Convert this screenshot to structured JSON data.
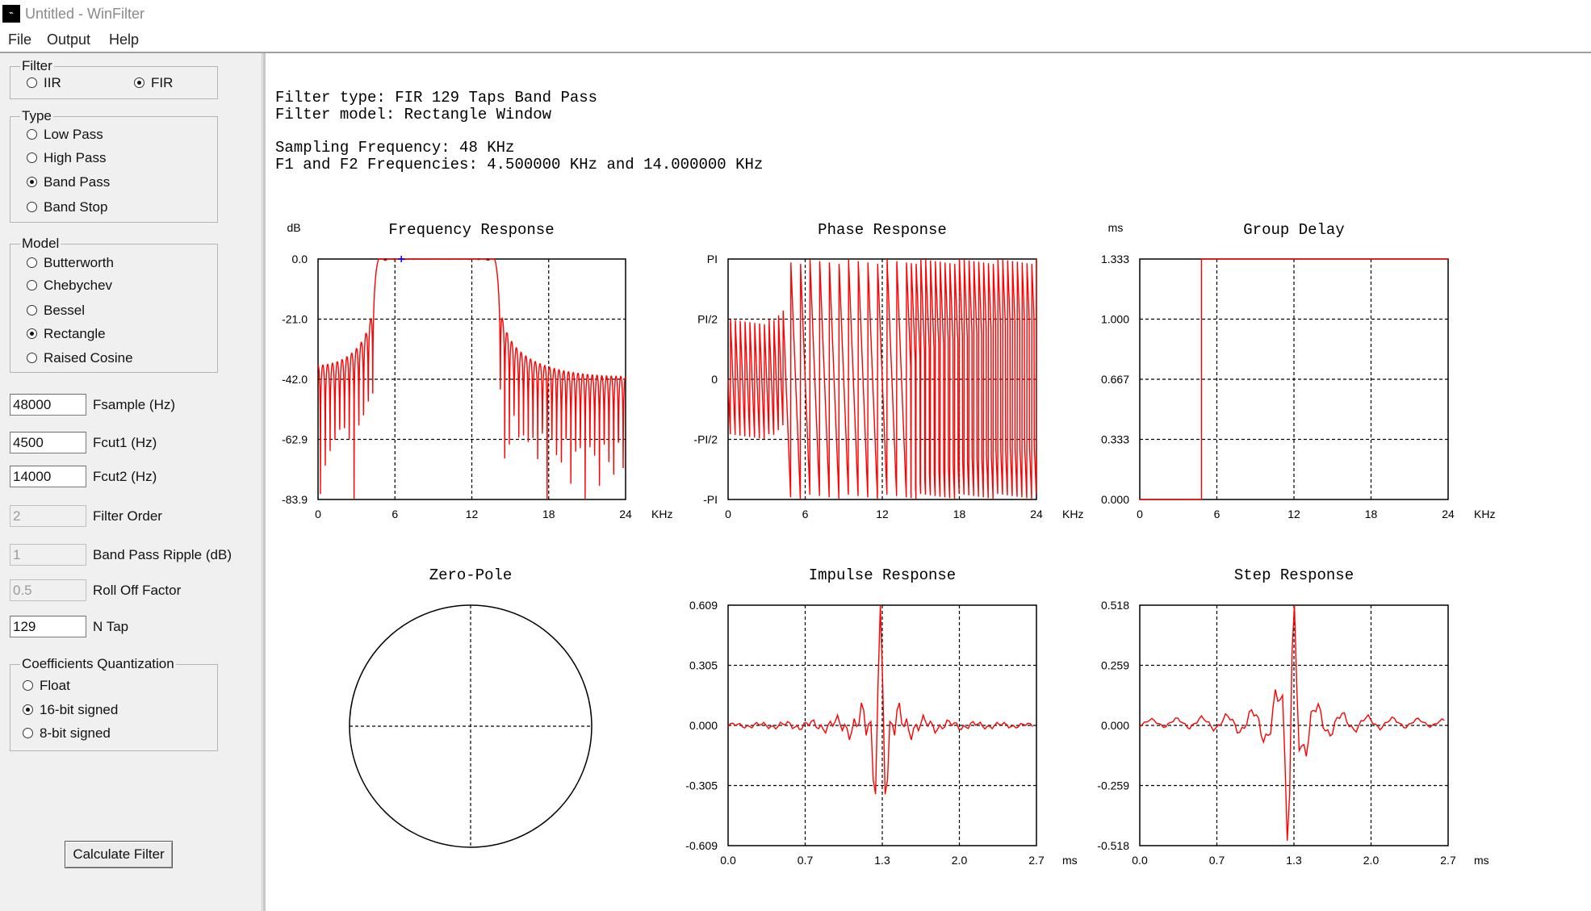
{
  "window": {
    "title": "Untitled - WinFilter",
    "app_icon_glyph": "⌁"
  },
  "menu": {
    "items": [
      "File",
      "Output",
      "Help"
    ]
  },
  "filter_group": {
    "legend": "Filter",
    "options": [
      {
        "label": "IIR",
        "selected": false
      },
      {
        "label": "FIR",
        "selected": true
      }
    ]
  },
  "type_group": {
    "legend": "Type",
    "options": [
      {
        "label": "Low Pass",
        "selected": false
      },
      {
        "label": "High Pass",
        "selected": false
      },
      {
        "label": "Band Pass",
        "selected": true
      },
      {
        "label": "Band Stop",
        "selected": false
      }
    ]
  },
  "model_group": {
    "legend": "Model",
    "options": [
      {
        "label": "Butterworth",
        "selected": false
      },
      {
        "label": "Chebychev",
        "selected": false
      },
      {
        "label": "Bessel",
        "selected": false
      },
      {
        "label": "Rectangle",
        "selected": true
      },
      {
        "label": "Raised Cosine",
        "selected": false
      }
    ]
  },
  "params": [
    {
      "value": "48000",
      "label": "Fsample (Hz)",
      "enabled": true
    },
    {
      "value": "4500",
      "label": "Fcut1 (Hz)",
      "enabled": true
    },
    {
      "value": "14000",
      "label": "Fcut2 (Hz)",
      "enabled": true
    },
    {
      "value": "2",
      "label": "Filter Order",
      "enabled": false
    },
    {
      "value": "1",
      "label": "Band Pass Ripple (dB)",
      "enabled": false
    },
    {
      "value": "0.5",
      "label": "Roll Off Factor",
      "enabled": false
    },
    {
      "value": "129",
      "label": "N Tap",
      "enabled": true
    }
  ],
  "quant_group": {
    "legend": "Coefficients Quantization",
    "options": [
      {
        "label": "Float",
        "selected": false
      },
      {
        "label": "16-bit signed",
        "selected": true
      },
      {
        "label": "8-bit signed",
        "selected": false
      }
    ]
  },
  "calculate_button": "Calculate Filter",
  "info": {
    "line1": "Filter type: FIR 129 Taps Band Pass",
    "line2": "Filter model: Rectangle Window",
    "line3": "Sampling Frequency: 48 KHz",
    "line4": "F1 and F2 Frequencies: 4.500000 KHz and 14.000000 KHz"
  },
  "colors": {
    "trace": "#ff0000",
    "marker": "#0000ff",
    "grid": "#000000"
  },
  "chart_data": [
    {
      "id": "freq",
      "type": "line",
      "title": "Frequency Response",
      "ylabel": "dB",
      "xlabel": "KHz",
      "xlim": [
        0,
        24
      ],
      "ylim": [
        -83.9,
        0
      ],
      "xticks": [
        "0",
        "6",
        "12",
        "18",
        "24"
      ],
      "yticks": [
        "0.0",
        "-21.0",
        "-42.0",
        "-62.9",
        "-83.9"
      ],
      "params": {
        "taps": 129,
        "fs_khz": 48,
        "f1_khz": 4.5,
        "f2_khz": 14,
        "floor_db": -83.9
      },
      "marker_x": 6.5
    },
    {
      "id": "phase",
      "type": "line",
      "title": "Phase Response",
      "ylabel": "",
      "xlabel": "KHz",
      "xlim": [
        0,
        24
      ],
      "ylim": [
        -3.1416,
        3.1416
      ],
      "xticks": [
        "0",
        "6",
        "12",
        "18",
        "24"
      ],
      "yticks": [
        "PI",
        "PI/2",
        "0",
        "-PI/2",
        "-PI"
      ],
      "params": {
        "taps": 129,
        "fs_khz": 48,
        "f1_khz": 4.5,
        "f2_khz": 14
      }
    },
    {
      "id": "delay",
      "type": "line",
      "title": "Group Delay",
      "ylabel": "ms",
      "xlabel": "KHz",
      "xlim": [
        0,
        24
      ],
      "ylim": [
        0,
        1.333
      ],
      "xticks": [
        "0",
        "6",
        "12",
        "18",
        "24"
      ],
      "yticks": [
        "1.333",
        "1.000",
        "0.667",
        "0.333",
        "0.000"
      ],
      "x": [
        0,
        4.8,
        4.8,
        24
      ],
      "y": [
        0,
        0,
        1.333,
        1.333
      ]
    },
    {
      "id": "zp",
      "type": "scatter",
      "title": "Zero-Pole",
      "unit_circle": true
    },
    {
      "id": "impulse",
      "type": "line",
      "title": "Impulse Response",
      "xlabel": "ms",
      "xlim": [
        0,
        2.7
      ],
      "ylim": [
        -0.609,
        0.609
      ],
      "xticks": [
        "0.0",
        "0.7",
        "1.3",
        "2.0",
        "2.7"
      ],
      "yticks": [
        "0.609",
        "0.305",
        "0.000",
        "-0.305",
        "-0.609"
      ],
      "params": {
        "taps": 129,
        "fs_khz": 48,
        "f1_khz": 4.5,
        "f2_khz": 14,
        "peak": 0.609
      }
    },
    {
      "id": "step",
      "type": "line",
      "title": "Step Response",
      "xlabel": "ms",
      "xlim": [
        0,
        2.7
      ],
      "ylim": [
        -0.518,
        0.518
      ],
      "xticks": [
        "0.0",
        "0.7",
        "1.3",
        "2.0",
        "2.7"
      ],
      "yticks": [
        "0.518",
        "0.259",
        "0.000",
        "-0.259",
        "-0.518"
      ],
      "params": {
        "taps": 129,
        "fs_khz": 48,
        "f1_khz": 4.5,
        "f2_khz": 14,
        "peak": 0.518
      }
    }
  ]
}
